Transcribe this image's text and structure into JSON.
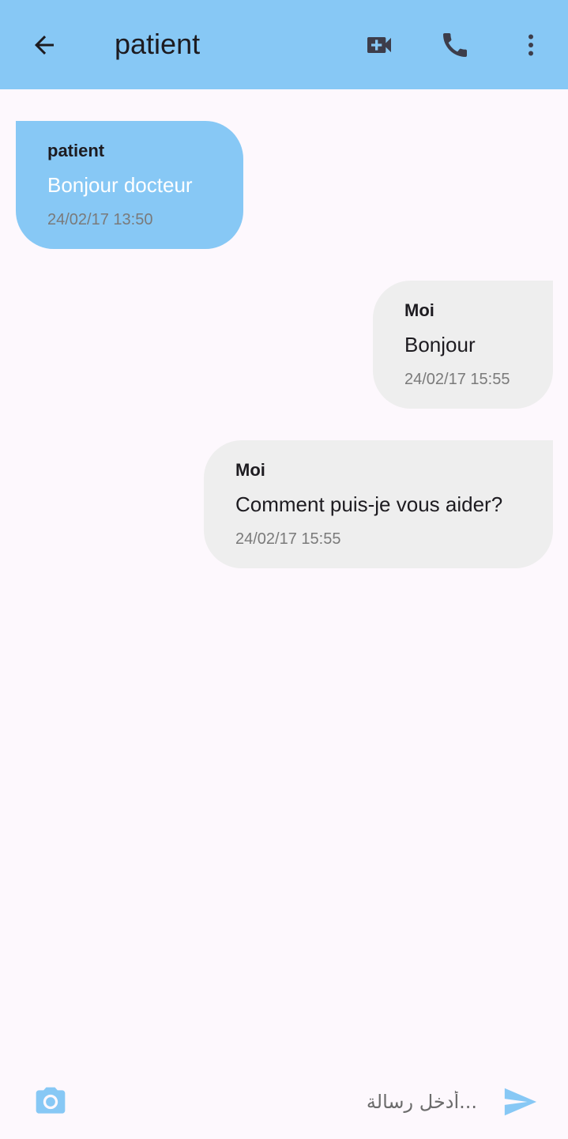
{
  "header": {
    "title": "patient",
    "back_icon": "arrow-back-icon",
    "video_icon": "video-call-icon",
    "call_icon": "phone-icon",
    "more_icon": "more-vert-icon"
  },
  "messages": [
    {
      "sender": "patient",
      "text": "Bonjour docteur",
      "time": "24/02/17 13:50",
      "direction": "incoming"
    },
    {
      "sender": "Moi",
      "text": "Bonjour",
      "time": "24/02/17 15:55",
      "direction": "outgoing"
    },
    {
      "sender": "Moi",
      "text": "Comment puis-je vous aider?",
      "time": "24/02/17 15:55",
      "direction": "outgoing"
    }
  ],
  "composer": {
    "placeholder": "أدخل رسالة...",
    "value": "",
    "camera_icon": "camera-icon",
    "send_icon": "send-icon"
  },
  "colors": {
    "accent": "#87c8f5",
    "background": "#fdf8fd",
    "outgoing_bubble": "#eeeeee",
    "icon_dark": "#3d3d4a"
  }
}
